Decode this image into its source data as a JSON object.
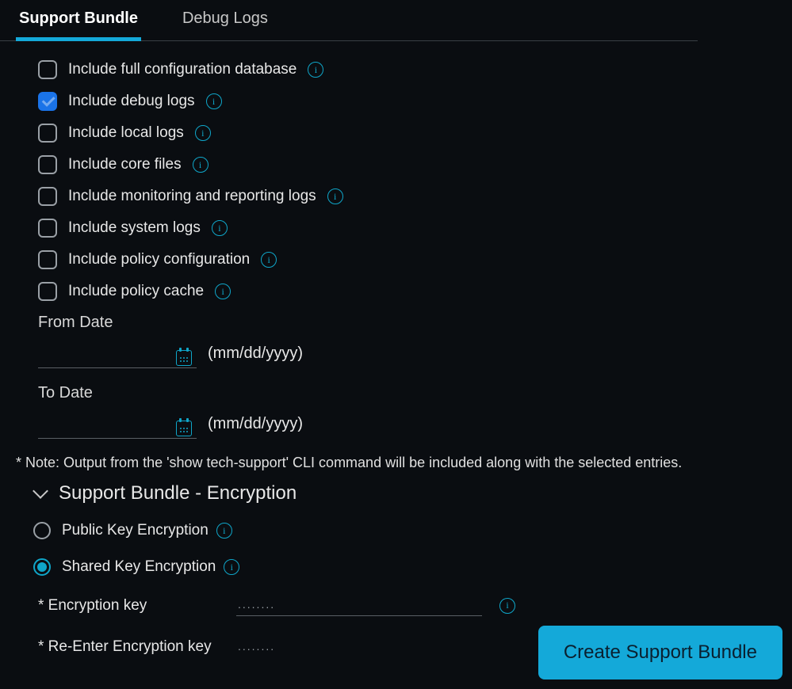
{
  "tabs": {
    "support_bundle": "Support Bundle",
    "debug_logs": "Debug Logs"
  },
  "checkboxes": [
    {
      "label": "Include full configuration database",
      "checked": false
    },
    {
      "label": "Include debug logs",
      "checked": true
    },
    {
      "label": "Include local logs",
      "checked": false
    },
    {
      "label": "Include core files",
      "checked": false
    },
    {
      "label": "Include monitoring and reporting logs",
      "checked": false
    },
    {
      "label": "Include system logs",
      "checked": false
    },
    {
      "label": "Include policy configuration",
      "checked": false
    },
    {
      "label": "Include policy cache",
      "checked": false
    }
  ],
  "dates": {
    "from_label": "From Date",
    "to_label": "To Date",
    "format_hint": "(mm/dd/yyyy)"
  },
  "note": "* Note: Output from the 'show tech-support' CLI command will be included along with the selected entries.",
  "encryption": {
    "section_title": "Support Bundle - Encryption",
    "public_label": "Public Key Encryption",
    "shared_label": "Shared Key Encryption",
    "selected": "shared",
    "key_label": "* Encryption key",
    "rekey_label": "* Re-Enter Encryption key",
    "placeholder": "........"
  },
  "buttons": {
    "create": "Create Support Bundle"
  }
}
